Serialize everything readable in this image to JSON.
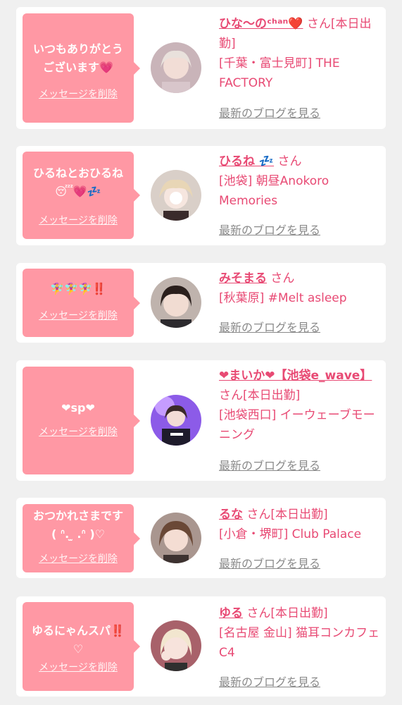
{
  "delete_label": "メッセージを削除",
  "blog_label": "最新のブログを見る",
  "colors": {
    "bubble": "#ff98a4",
    "accent": "#e84a74",
    "link_gray": "#8a8a8a"
  },
  "cards": [
    {
      "message": "いつもありがとう\nございます💗",
      "name": "ひな〜のᶜʰᵃⁿ❤️",
      "suffix": " さん[本日出勤]",
      "shop": "[千葉・富士見町] THE FACTORY"
    },
    {
      "message": "ひるねとおひるね\n😴💗💤",
      "name": "ひるね 💤",
      "suffix": " さん",
      "shop": "[池袋] 朝昼Anokoro Memories"
    },
    {
      "message": "🧚‍♀️🧚‍♀️🧚‍♀️‼️",
      "name": "みそまる",
      "suffix": " さん",
      "shop": "[秋葉原] #Melt asleep"
    },
    {
      "message": "❤sp❤",
      "name": "❤まいか❤【池袋e_wave】",
      "suffix": " さん[本日出勤]",
      "shop": "[池袋西口] イーウェーブモーニング"
    },
    {
      "message": "おつかれさまです\n(  ᐢ. ̫ .ᐢ  )♡",
      "name": "るな",
      "suffix": " さん[本日出勤]",
      "shop": "[小倉・堺町] Club Palace"
    },
    {
      "message": "ゆるにゃんスパ‼️\n♡",
      "name": "ゆる",
      "suffix": " さん[本日出勤]",
      "shop": "[名古屋 金山] 猫耳コンカフェ C4"
    }
  ]
}
